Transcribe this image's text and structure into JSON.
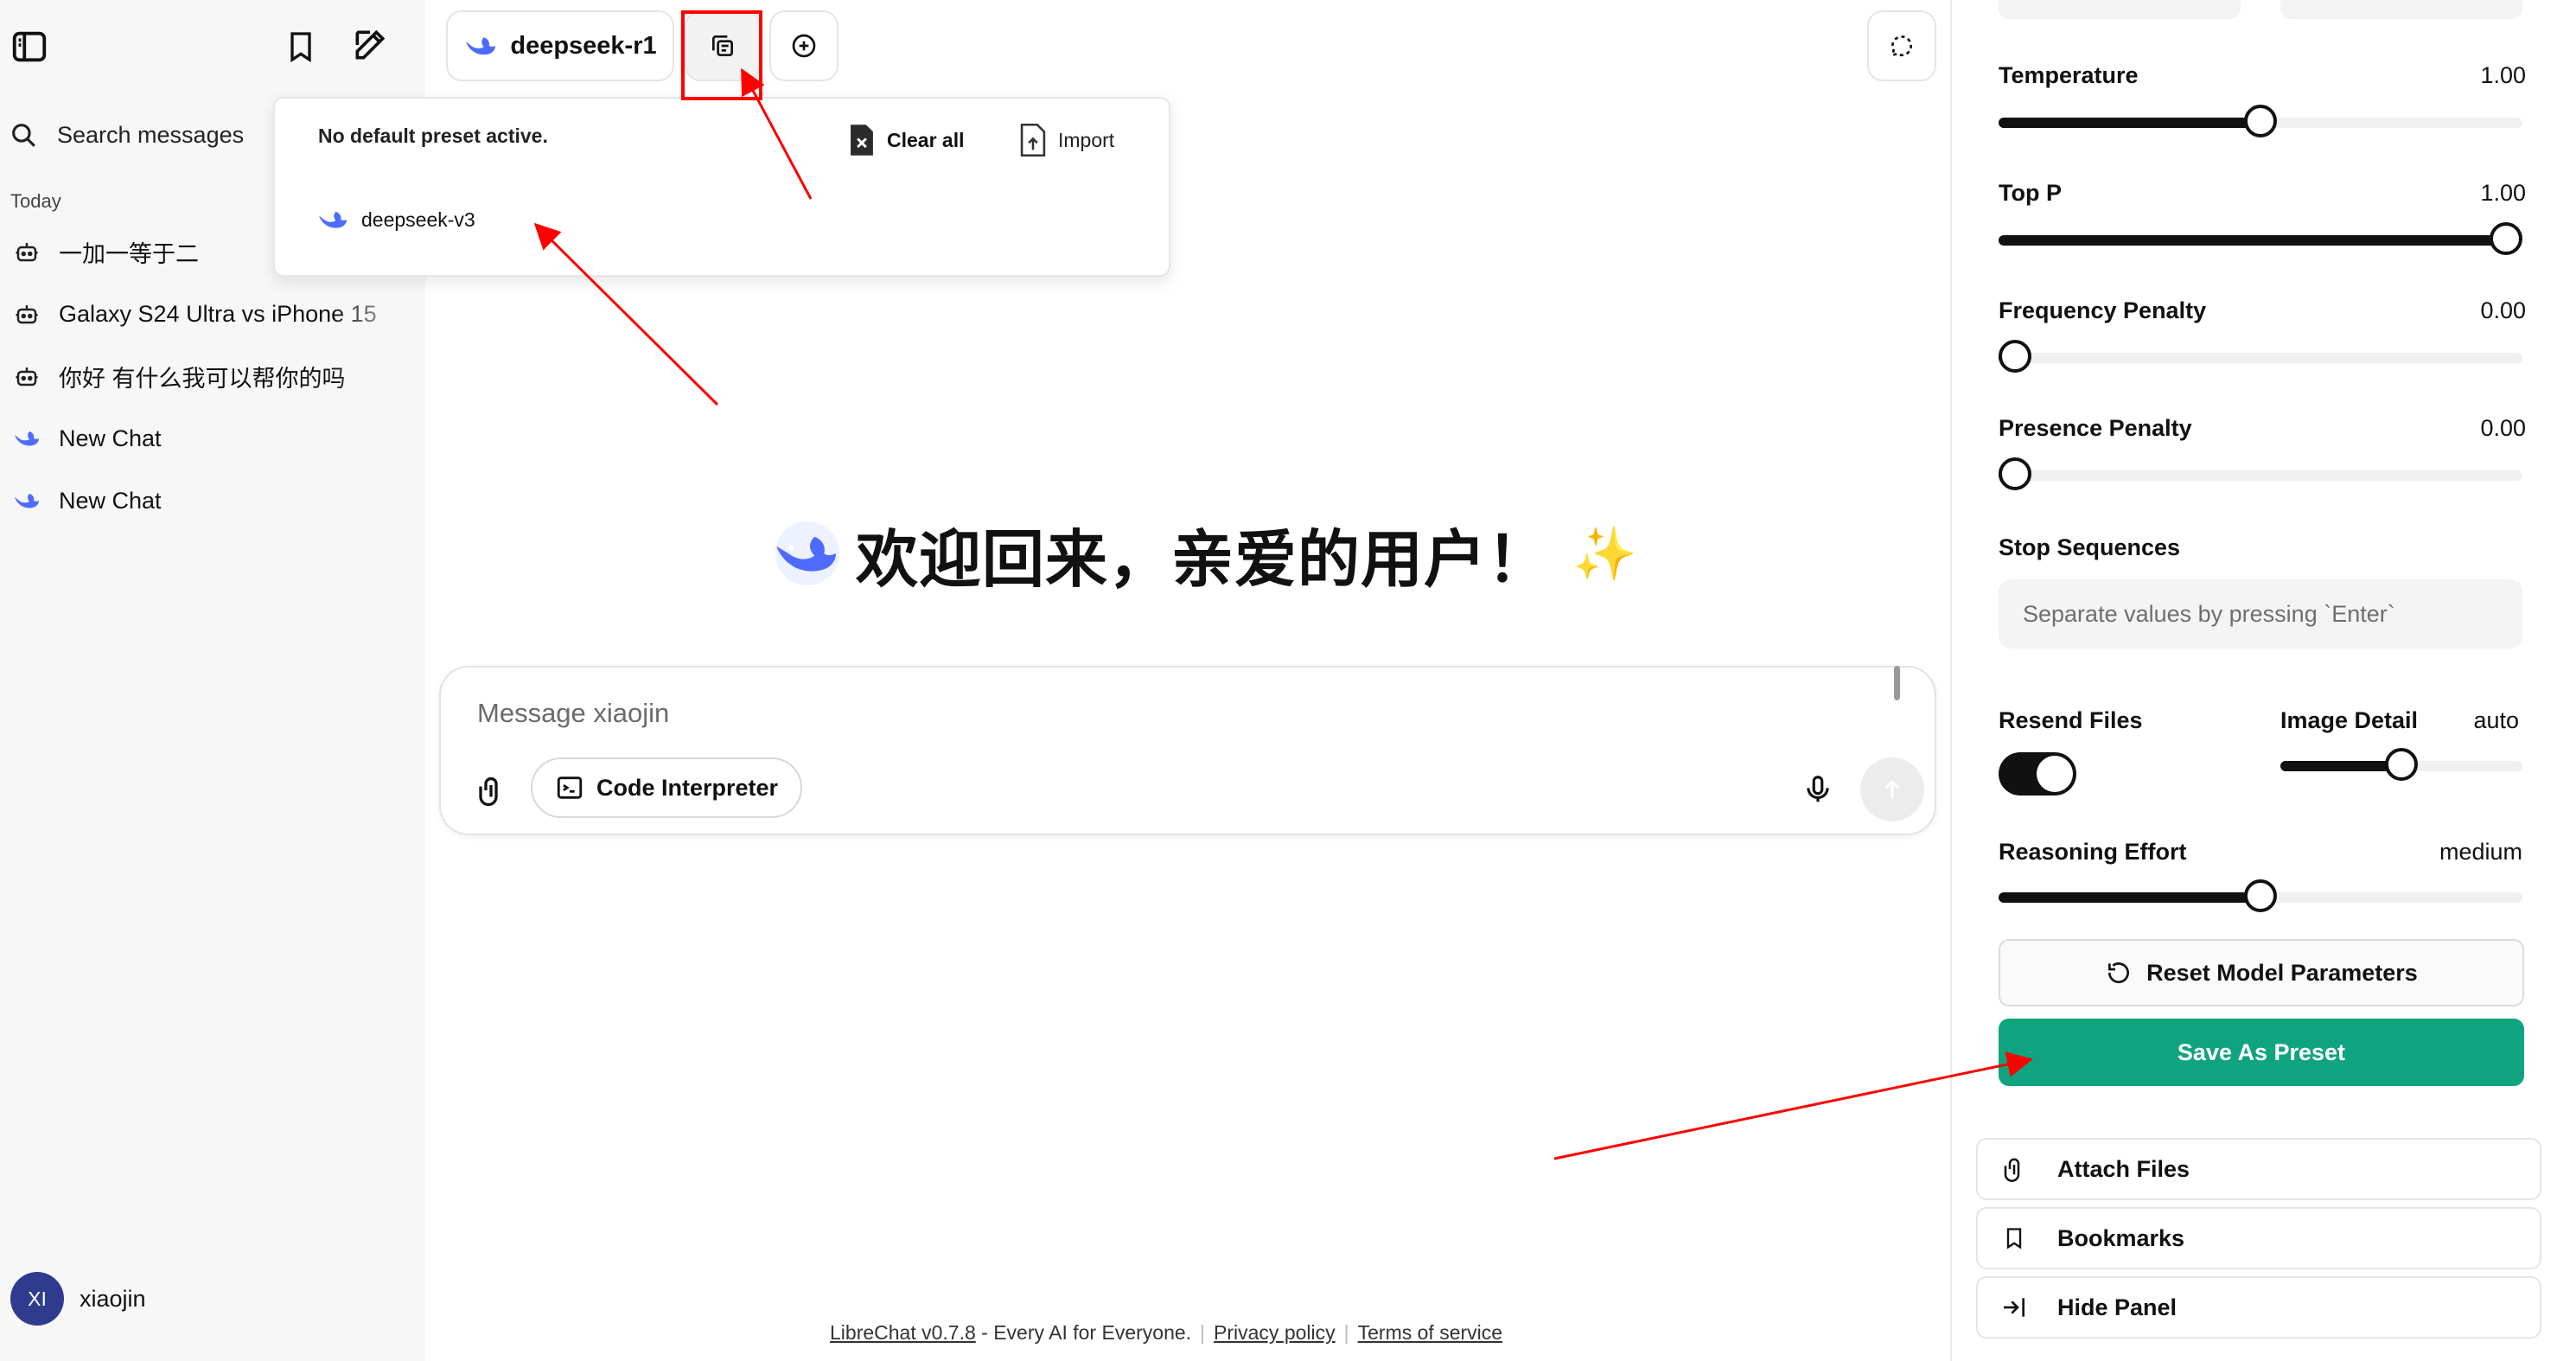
{
  "sidebar": {
    "search_label": "Search messages",
    "section_today": "Today",
    "items": [
      {
        "label": "一加一等于二",
        "icon": "bot-icon"
      },
      {
        "label": "Galaxy S24 Ultra vs iPhone 15",
        "icon": "bot-icon"
      },
      {
        "label": "你好 有什么我可以帮你的吗",
        "icon": "bot-icon"
      },
      {
        "label": "New Chat",
        "icon": "deepseek-whale-icon"
      },
      {
        "label": "New Chat",
        "icon": "deepseek-whale-icon"
      }
    ],
    "user": {
      "initials": "XI",
      "name": "xiaojin"
    }
  },
  "topbar": {
    "model_name": "deepseek-r1"
  },
  "preset_menu": {
    "title": "No default preset active.",
    "clear_all": "Clear all",
    "import": "Import",
    "items": [
      {
        "label": "deepseek-v3"
      }
    ]
  },
  "main": {
    "welcome": "欢迎回来，亲爱的用户！",
    "sparkle": "✨",
    "message_placeholder": "Message xiaojin",
    "code_interpreter": "Code Interpreter"
  },
  "footer": {
    "brand": "LibreChat v0.7.8",
    "tagline": " - Every AI for Everyone.",
    "privacy": "Privacy policy",
    "terms": "Terms of service"
  },
  "right_panel": {
    "params": {
      "temperature": {
        "label": "Temperature",
        "value": "1.00",
        "level": 0.5
      },
      "top_p": {
        "label": "Top P",
        "value": "1.00",
        "level": 1.0
      },
      "frequency_penalty": {
        "label": "Frequency Penalty",
        "value": "0.00",
        "level": 0.0
      },
      "presence_penalty": {
        "label": "Presence Penalty",
        "value": "0.00",
        "level": 0.0
      }
    },
    "stop_sequences": {
      "label": "Stop Sequences",
      "placeholder": "Separate values by pressing `Enter`"
    },
    "resend_files": {
      "label": "Resend Files",
      "on": true
    },
    "image_detail": {
      "label": "Image Detail",
      "value": "auto",
      "level": 0.5
    },
    "reasoning_effort": {
      "label": "Reasoning Effort",
      "value": "medium",
      "level": 0.5
    },
    "reset_button": "Reset Model Parameters",
    "save_button": "Save As Preset",
    "links": [
      {
        "label": "Attach Files",
        "icon": "paperclip-icon"
      },
      {
        "label": "Bookmarks",
        "icon": "bookmark-icon"
      },
      {
        "label": "Hide Panel",
        "icon": "hide-panel-icon"
      }
    ]
  },
  "colors": {
    "save_green": "#10a37f",
    "annotation_red": "#ff0000",
    "deepseek_blue": "#4d6bfe"
  }
}
